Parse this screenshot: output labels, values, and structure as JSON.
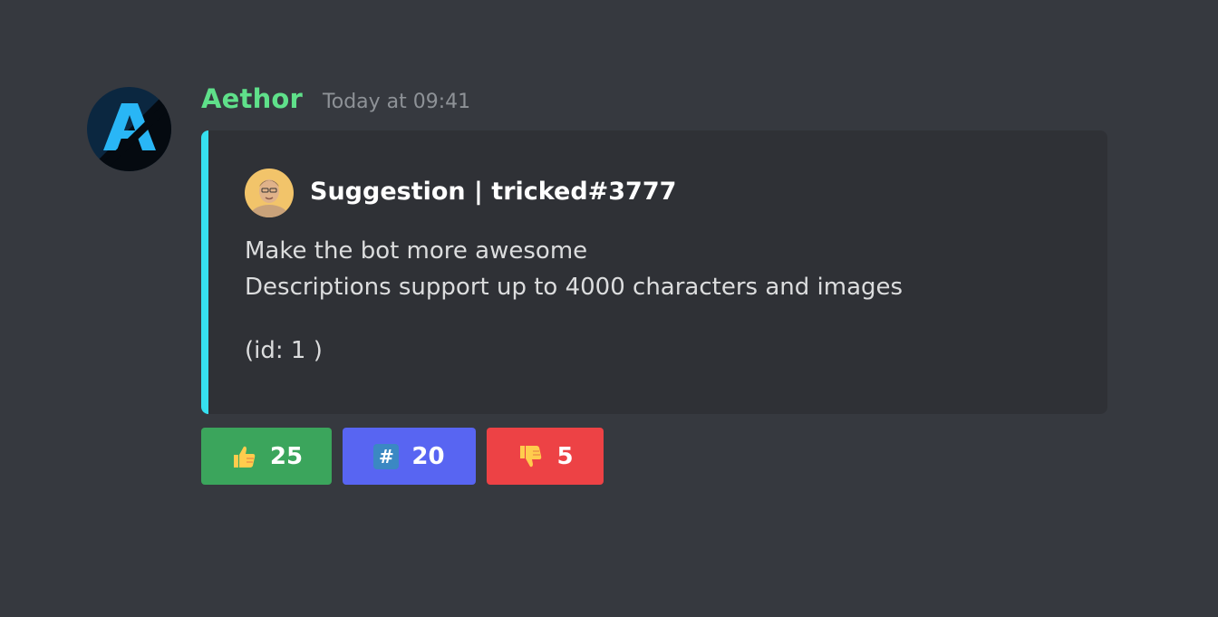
{
  "message": {
    "username": "Aethor",
    "timestamp": "Today at 09:41",
    "avatar_icon": "aethor-logo-icon",
    "username_color": "#5fe08a"
  },
  "embed": {
    "accent_color": "#36e0f0",
    "author_name": "Suggestion | tricked#3777",
    "author_avatar_icon": "user-avatar-photo",
    "description_lines": [
      "Make the bot more awesome",
      "Descriptions support up to 4000 characters and images",
      "(id: 1 )"
    ]
  },
  "buttons": [
    {
      "icon": "thumbs-up-icon",
      "count": "25",
      "color": "#3ba55c"
    },
    {
      "icon": "hash-icon",
      "count": "20",
      "color": "#5865f2"
    },
    {
      "icon": "thumbs-down-icon",
      "count": "5",
      "color": "#ed4245"
    }
  ]
}
